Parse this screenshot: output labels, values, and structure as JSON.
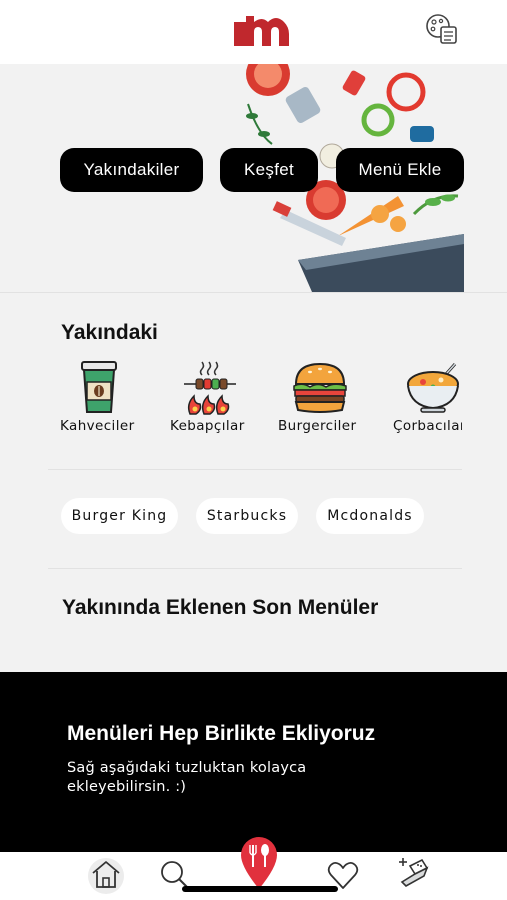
{
  "brand": {
    "logo_letter": "m",
    "color": "#c0282d"
  },
  "header": {
    "menu_icon": "menu-book-icon"
  },
  "hero": {
    "buttons": [
      "Yakındakiler",
      "Keşfet",
      "Menü Ekle"
    ]
  },
  "nearby": {
    "title": "Yakındaki",
    "categories": [
      {
        "label": "Kahveciler",
        "icon": "coffee-cup-icon"
      },
      {
        "label": "Kebapçılar",
        "icon": "kebab-grill-icon"
      },
      {
        "label": "Burgerciler",
        "icon": "burger-icon"
      },
      {
        "label": "Çorbacılar",
        "icon": "soup-bowl-icon"
      }
    ],
    "places": [
      "Burger King",
      "Starbucks",
      "Mcdonalds"
    ]
  },
  "recent": {
    "title": "Yakınında Eklenen Son Menüler"
  },
  "promo": {
    "title": "Menüleri Hep Birlikte Ekliyoruz",
    "text": "Sağ aşağıdaki tuzluktan kolayca ekleyebilirsin. :)"
  },
  "bottom_nav": {
    "items": [
      "home-icon",
      "search-icon",
      "location-pin-icon",
      "heart-icon",
      "salt-shaker-icon"
    ]
  }
}
